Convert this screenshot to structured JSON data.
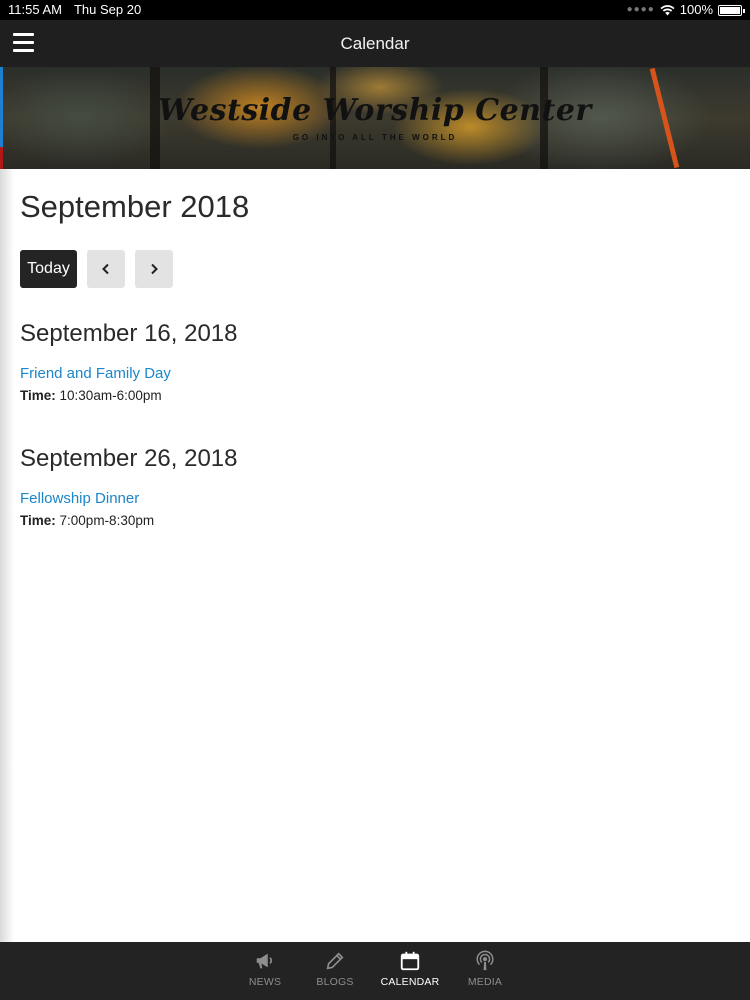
{
  "status_bar": {
    "time": "11:55 AM",
    "date": "Thu Sep 20",
    "battery": "100%"
  },
  "header": {
    "title": "Calendar"
  },
  "banner": {
    "title": "Westside Worship Center",
    "subtitle": "GO INTO ALL THE WORLD"
  },
  "calendar": {
    "month_title": "September 2018",
    "today_label": "Today",
    "prev_icon": "chevron-left-icon",
    "next_icon": "chevron-right-icon",
    "days": [
      {
        "date": "September 16, 2018",
        "events": [
          {
            "title": "Friend and Family Day",
            "time_label": "Time:",
            "time": "10:30am-6:00pm"
          }
        ]
      },
      {
        "date": "September 26, 2018",
        "events": [
          {
            "title": "Fellowship Dinner",
            "time_label": "Time:",
            "time": "7:00pm-8:30pm"
          }
        ]
      }
    ]
  },
  "tab_bar": {
    "tabs": [
      {
        "label": "NEWS",
        "icon": "megaphone-icon",
        "active": false
      },
      {
        "label": "BLOGS",
        "icon": "pencil-icon",
        "active": false
      },
      {
        "label": "CALENDAR",
        "icon": "calendar-icon",
        "active": true
      },
      {
        "label": "MEDIA",
        "icon": "podcast-icon",
        "active": false
      }
    ]
  },
  "colors": {
    "link": "#1b86c9",
    "nav_bg": "#1f1f1f",
    "tab_bar_bg": "#232323",
    "today_button_bg": "#242424"
  }
}
